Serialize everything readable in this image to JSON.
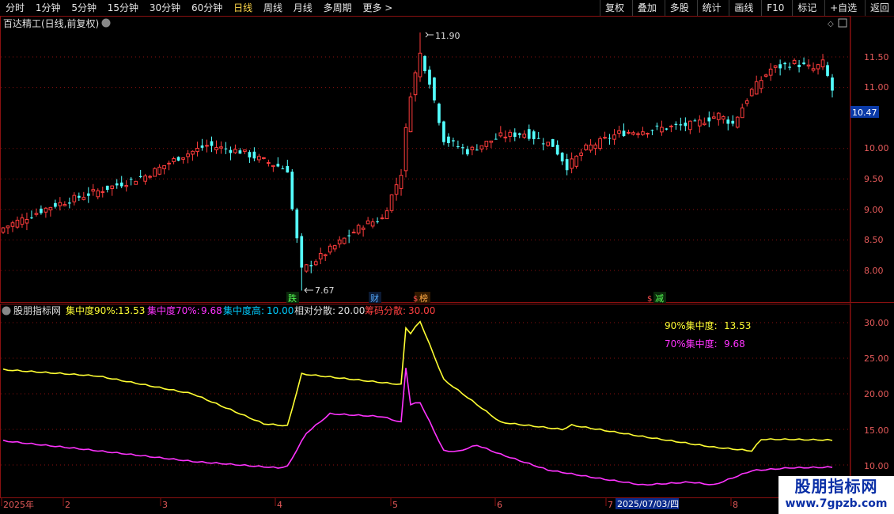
{
  "toolbar": {
    "periods": [
      "分时",
      "1分钟",
      "5分钟",
      "15分钟",
      "30分钟",
      "60分钟",
      "日线",
      "周线",
      "月线",
      "多周期",
      "更多 >"
    ],
    "active_period": "日线",
    "actions": [
      "复权",
      "叠加",
      "多股",
      "统计",
      "画线",
      "F10",
      "标记",
      "+自选",
      "返回"
    ]
  },
  "colors": {
    "up": "#ff3c3c",
    "down": "#54ffff",
    "line90": "#ffff33",
    "line70": "#ff33ff",
    "grid": "#8a1010",
    "label_high": "#00ccff",
    "label_rel": "#e0e0e0",
    "label_spread": "#ff4040"
  },
  "main_panel": {
    "title": "百达精工(日线,前复权)",
    "y_ticks": [
      "11.50",
      "11.00",
      "10.00",
      "9.50",
      "9.00",
      "8.50",
      "8.00"
    ],
    "current_price": "10.47",
    "high_marker": "11.90",
    "low_marker": "7.67",
    "event_tags": [
      {
        "text": "跌",
        "color": "#55ff55"
      },
      {
        "text": "财",
        "color": "#55aaff"
      },
      {
        "text": "榜",
        "color": "#ffaa44"
      },
      {
        "text": "减",
        "color": "#55ff55"
      }
    ]
  },
  "indicator_panel": {
    "name": "股朋指标网",
    "values": [
      {
        "label": "集中度90%:",
        "value": "13.53"
      },
      {
        "label": "集中度70%:",
        "value": "9.68"
      },
      {
        "label": "集中度高:",
        "value": "10.00"
      },
      {
        "label": "相对分散:",
        "value": "20.00"
      },
      {
        "label": "筹码分散:",
        "value": "30.00"
      }
    ],
    "legend_90_label": "90%集中度:",
    "legend_90_value": "13.53",
    "legend_70_label": "70%集中度:",
    "legend_70_value": "9.68",
    "y_ticks": [
      "30.00",
      "25.00",
      "20.00",
      "15.00",
      "10.00"
    ]
  },
  "x_axis": {
    "labels": [
      "2025年",
      "2",
      "3",
      "4",
      "5",
      "6",
      "7",
      "2025/07/03/四",
      "8"
    ]
  },
  "watermark": {
    "title": "股朋指标网",
    "url": "www.7gpzb.com"
  },
  "chart_data": {
    "type": "candlestick",
    "price_range": [
      7.5,
      11.9
    ],
    "price_anchors": [
      {
        "i": 0,
        "close": 8.7
      },
      {
        "i": 10,
        "close": 9.05
      },
      {
        "i": 20,
        "close": 9.3
      },
      {
        "i": 30,
        "close": 9.55
      },
      {
        "i": 37,
        "close": 9.85
      },
      {
        "i": 43,
        "close": 10.05
      },
      {
        "i": 50,
        "close": 9.95
      },
      {
        "i": 55,
        "close": 9.8
      },
      {
        "i": 60,
        "close": 9.65
      },
      {
        "i": 61,
        "close": 9.0
      },
      {
        "i": 63,
        "close": 8.0
      },
      {
        "i": 70,
        "close": 8.4
      },
      {
        "i": 76,
        "close": 8.75
      },
      {
        "i": 80,
        "close": 8.85
      },
      {
        "i": 84,
        "close": 9.6
      },
      {
        "i": 85,
        "close": 10.3
      },
      {
        "i": 86,
        "close": 10.9
      },
      {
        "i": 88,
        "close": 11.55
      },
      {
        "i": 90,
        "close": 11.1
      },
      {
        "i": 93,
        "close": 10.15
      },
      {
        "i": 98,
        "close": 9.95
      },
      {
        "i": 105,
        "close": 10.2
      },
      {
        "i": 110,
        "close": 10.25
      },
      {
        "i": 116,
        "close": 10.05
      },
      {
        "i": 119,
        "close": 9.7
      },
      {
        "i": 123,
        "close": 10.0
      },
      {
        "i": 130,
        "close": 10.25
      },
      {
        "i": 136,
        "close": 10.3
      },
      {
        "i": 141,
        "close": 10.35
      },
      {
        "i": 146,
        "close": 10.4
      },
      {
        "i": 151,
        "close": 10.55
      },
      {
        "i": 154,
        "close": 10.4
      },
      {
        "i": 158,
        "close": 10.95
      },
      {
        "i": 162,
        "close": 11.3
      },
      {
        "i": 167,
        "close": 11.4
      },
      {
        "i": 171,
        "close": 11.3
      },
      {
        "i": 173,
        "close": 11.4
      },
      {
        "i": 175,
        "close": 10.95
      }
    ],
    "concentration_90": [
      {
        "i": 0,
        "v": 23.4
      },
      {
        "i": 20,
        "v": 22.5
      },
      {
        "i": 40,
        "v": 20.0
      },
      {
        "i": 55,
        "v": 15.8
      },
      {
        "i": 60,
        "v": 15.5
      },
      {
        "i": 63,
        "v": 22.8
      },
      {
        "i": 84,
        "v": 21.3
      },
      {
        "i": 85,
        "v": 29.3
      },
      {
        "i": 86,
        "v": 28.5
      },
      {
        "i": 88,
        "v": 30.2
      },
      {
        "i": 93,
        "v": 22.0
      },
      {
        "i": 100,
        "v": 18.5
      },
      {
        "i": 105,
        "v": 16.0
      },
      {
        "i": 118,
        "v": 15.0
      },
      {
        "i": 120,
        "v": 15.6
      },
      {
        "i": 135,
        "v": 14.0
      },
      {
        "i": 150,
        "v": 12.5
      },
      {
        "i": 158,
        "v": 12.0
      },
      {
        "i": 160,
        "v": 13.6
      },
      {
        "i": 166,
        "v": 13.6
      },
      {
        "i": 175,
        "v": 13.5
      }
    ],
    "concentration_70": [
      {
        "i": 0,
        "v": 13.4
      },
      {
        "i": 20,
        "v": 12.0
      },
      {
        "i": 40,
        "v": 10.5
      },
      {
        "i": 58,
        "v": 9.6
      },
      {
        "i": 60,
        "v": 9.8
      },
      {
        "i": 64,
        "v": 14.5
      },
      {
        "i": 69,
        "v": 17.2
      },
      {
        "i": 80,
        "v": 16.8
      },
      {
        "i": 84,
        "v": 16.0
      },
      {
        "i": 85,
        "v": 23.7
      },
      {
        "i": 86,
        "v": 18.5
      },
      {
        "i": 88,
        "v": 18.8
      },
      {
        "i": 93,
        "v": 12.0
      },
      {
        "i": 96,
        "v": 11.9
      },
      {
        "i": 100,
        "v": 12.8
      },
      {
        "i": 105,
        "v": 11.5
      },
      {
        "i": 115,
        "v": 9.3
      },
      {
        "i": 125,
        "v": 8.2
      },
      {
        "i": 135,
        "v": 7.2
      },
      {
        "i": 145,
        "v": 7.6
      },
      {
        "i": 150,
        "v": 7.2
      },
      {
        "i": 158,
        "v": 9.2
      },
      {
        "i": 166,
        "v": 9.6
      },
      {
        "i": 175,
        "v": 9.7
      }
    ],
    "indicator_range": [
      7.0,
      31.0
    ],
    "count": 176
  }
}
